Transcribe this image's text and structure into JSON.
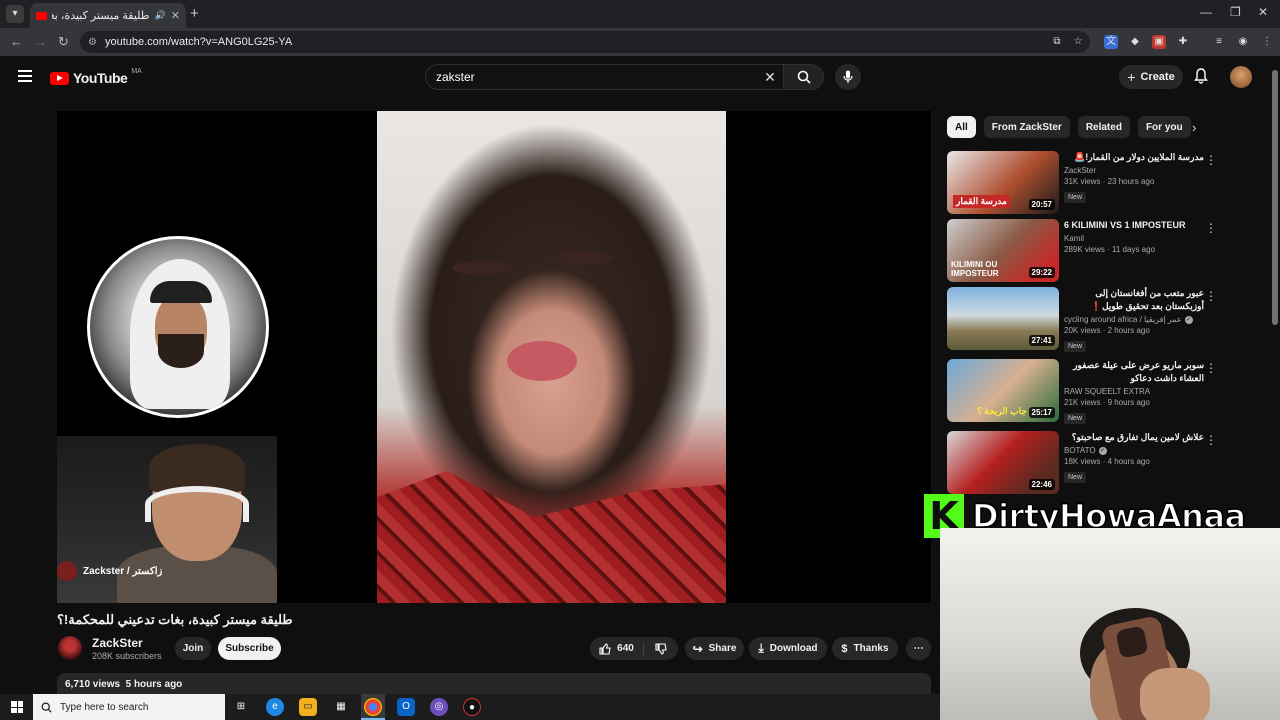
{
  "browser": {
    "tab_title": "طليقة ميستر كبيدة، بغات تدعيني للمحكمة!؟ - YouTube",
    "url": "youtube.com/watch?v=ANG0LG25-YA"
  },
  "youtube": {
    "logo_text": "YouTube",
    "country_code": "MA",
    "search_query": "zakster",
    "create_label": "Create"
  },
  "video": {
    "title": "طليقة ميستر كبيدة، بغات تدعيني للمحكمة!؟",
    "webcam_tag": "Zackster / زاكستر",
    "channel_name": "ZackSter",
    "subscribers": "208K subscribers",
    "join_label": "Join",
    "subscribe_label": "Subscribe",
    "likes": "640",
    "share_label": "Share",
    "download_label": "Download",
    "thanks_label": "Thanks",
    "views": "6,710 views",
    "uploaded": "5 hours ago"
  },
  "chips": [
    "All",
    "From ZackSter",
    "Related",
    "For you"
  ],
  "recommendations": [
    {
      "title": "مدرسة الملايين دولار من القمار!🚨",
      "channel": "ZackSter",
      "verified": false,
      "views": "31K views",
      "age": "23 hours ago",
      "duration": "20:57",
      "badge": "New",
      "thumb_caption": "مدرسة القمار",
      "rtl": true
    },
    {
      "title": "6 KILIMINI VS 1 IMPOSTEUR",
      "channel": "Kamil",
      "verified": false,
      "views": "289K views",
      "age": "11 days ago",
      "duration": "29:22",
      "badge": "",
      "thumb_caption": "KILIMINI OU IMPOSTEUR",
      "rtl": false
    },
    {
      "title": "عبور متعب من أفغانستان إلى أوزبكستان بعد تحقيق طويل❗",
      "channel": "cycling around africa / عمر إفريقيا",
      "verified": true,
      "views": "20K views",
      "age": "2 hours ago",
      "duration": "27:41",
      "badge": "New",
      "thumb_caption": "",
      "rtl": true
    },
    {
      "title": "سوبر ماريو عرض على عيلة عصفور العشاء داشت دعاكو",
      "channel": "RAW SQUEELT EXTRA",
      "verified": false,
      "views": "21K views",
      "age": "9 hours ago",
      "duration": "25:17",
      "badge": "New",
      "thumb_caption": "جاب الربحة ؟",
      "rtl": true
    },
    {
      "title": "علاش لامين يمال تفارق مع صاحبتو؟",
      "channel": "BOTATO",
      "verified": true,
      "views": "18K views",
      "age": "4 hours ago",
      "duration": "22:46",
      "badge": "New",
      "thumb_caption": "",
      "rtl": true
    }
  ],
  "overlay": {
    "brand_letter": "K",
    "streamer_name": "DirtyHowaAnaa"
  },
  "taskbar": {
    "search_placeholder": "Type here to search"
  },
  "colors": {
    "youtube_red": "#ff0000",
    "kick_green": "#53fc18",
    "page_bg": "#0f0f0f"
  }
}
